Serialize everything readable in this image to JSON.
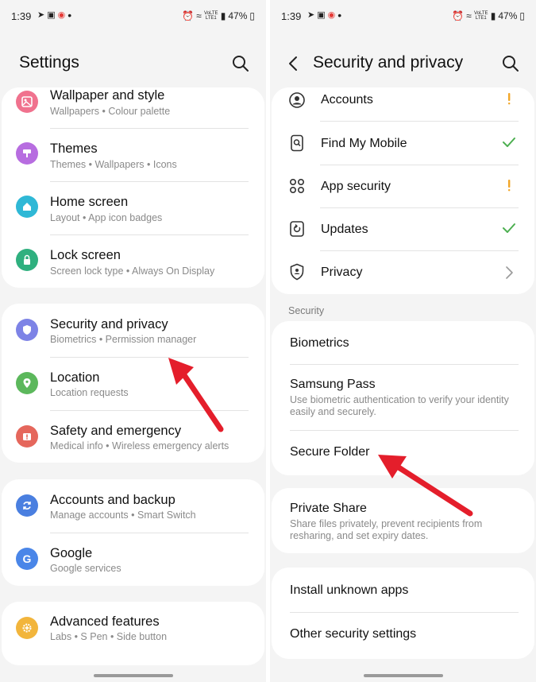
{
  "status_bar": {
    "time": "1:39",
    "network": "VoLTE LTE1",
    "battery": "47%"
  },
  "left": {
    "title": "Settings",
    "items": [
      {
        "name": "wallpaper",
        "title": "Wallpaper and style",
        "sub": "Wallpapers  •  Colour palette",
        "icon": "wallpaper-icon",
        "color": "#f0728e"
      },
      {
        "name": "themes",
        "title": "Themes",
        "sub": "Themes  •  Wallpapers  •  Icons",
        "icon": "themes-icon",
        "color": "#b76de0"
      },
      {
        "name": "home-screen",
        "title": "Home screen",
        "sub": "Layout  •  App icon badges",
        "icon": "home-icon",
        "color": "#2fb8d6"
      },
      {
        "name": "lock-screen",
        "title": "Lock screen",
        "sub": "Screen lock type  •  Always On Display",
        "icon": "lock-icon",
        "color": "#2fb07f"
      },
      {
        "name": "security-privacy",
        "title": "Security and privacy",
        "sub": "Biometrics  •  Permission manager",
        "icon": "shield-icon",
        "color": "#7d83e6"
      },
      {
        "name": "location",
        "title": "Location",
        "sub": "Location requests",
        "icon": "location-pin-icon",
        "color": "#5cb85c"
      },
      {
        "name": "safety-emergency",
        "title": "Safety and emergency",
        "sub": "Medical info  •  Wireless emergency alerts",
        "icon": "emergency-icon",
        "color": "#e5675c"
      },
      {
        "name": "accounts-backup",
        "title": "Accounts and backup",
        "sub": "Manage accounts  •  Smart Switch",
        "icon": "sync-icon",
        "color": "#4a7fe0"
      },
      {
        "name": "google",
        "title": "Google",
        "sub": "Google services",
        "icon": "google-icon",
        "color": "#4a86e8"
      },
      {
        "name": "advanced-features",
        "title": "Advanced features",
        "sub": "Labs  •  S Pen  •  Side button",
        "icon": "gear-plus-icon",
        "color": "#f2b53c"
      }
    ]
  },
  "right": {
    "title": "Security and privacy",
    "top_items": [
      {
        "name": "accounts",
        "title": "Accounts",
        "icon": "account-icon",
        "status": "warning"
      },
      {
        "name": "find-my-mobile",
        "title": "Find My Mobile",
        "icon": "find-mobile-icon",
        "status": "ok"
      },
      {
        "name": "app-security",
        "title": "App security",
        "icon": "app-grid-icon",
        "status": "warning"
      },
      {
        "name": "updates",
        "title": "Updates",
        "icon": "update-icon",
        "status": "ok"
      },
      {
        "name": "privacy",
        "title": "Privacy",
        "icon": "privacy-shield-icon",
        "status": "chevron"
      }
    ],
    "section_label": "Security",
    "security_items": [
      {
        "name": "biometrics",
        "title": "Biometrics",
        "sub": ""
      },
      {
        "name": "samsung-pass",
        "title": "Samsung Pass",
        "sub": "Use biometric authentication to verify your identity easily and securely."
      },
      {
        "name": "secure-folder",
        "title": "Secure Folder",
        "sub": ""
      }
    ],
    "private_share": {
      "title": "Private Share",
      "sub": "Share files privately, prevent recipients from resharing, and set expiry dates."
    },
    "other_items": [
      {
        "name": "install-unknown-apps",
        "title": "Install unknown apps"
      },
      {
        "name": "other-security-settings",
        "title": "Other security settings"
      }
    ]
  },
  "colors": {
    "warning": "#f2a628",
    "ok": "#4caf50",
    "arrow": "#e41e2b"
  }
}
